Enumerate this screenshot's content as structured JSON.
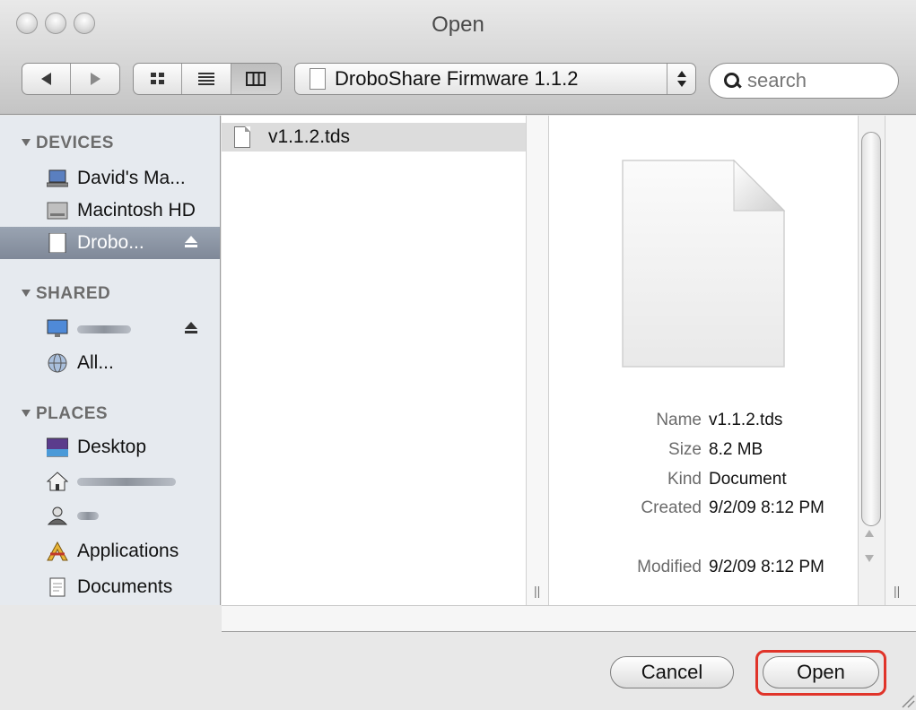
{
  "window": {
    "title": "Open"
  },
  "toolbar": {
    "location": "DroboShare Firmware 1.1.2",
    "search_placeholder": "search"
  },
  "sidebar": {
    "sections": [
      {
        "heading": "DEVICES",
        "items": [
          {
            "label": "David's Ma...",
            "icon": "laptop-icon"
          },
          {
            "label": "Macintosh HD",
            "icon": "hard-drive-icon"
          },
          {
            "label": "Drobo...",
            "icon": "external-drive-icon",
            "selected": true,
            "ejectable": true
          }
        ]
      },
      {
        "heading": "SHARED",
        "items": [
          {
            "label": "",
            "icon": "monitor-icon",
            "ejectable": true
          },
          {
            "label": "All...",
            "icon": "network-globe-icon"
          }
        ]
      },
      {
        "heading": "PLACES",
        "items": [
          {
            "label": "Desktop",
            "icon": "desktop-icon"
          },
          {
            "label": "",
            "icon": "home-icon"
          },
          {
            "label": "",
            "icon": "user-icon"
          },
          {
            "label": "Applications",
            "icon": "applications-icon"
          },
          {
            "label": "Documents",
            "icon": "documents-icon"
          }
        ]
      }
    ]
  },
  "browser": {
    "files": [
      {
        "name": "v1.1.2.tds",
        "selected": true
      }
    ]
  },
  "preview": {
    "name_label": "Name",
    "name_value": "v1.1.2.tds",
    "size_label": "Size",
    "size_value": "8.2 MB",
    "kind_label": "Kind",
    "kind_value": "Document",
    "created_label": "Created",
    "created_value": "9/2/09 8:12 PM",
    "modified_label": "Modified",
    "modified_value": "9/2/09 8:12 PM"
  },
  "buttons": {
    "cancel": "Cancel",
    "open": "Open"
  },
  "colors": {
    "highlight": "#e0342a",
    "sidebar_bg": "#e6eaef",
    "selection": "#7f8898"
  }
}
